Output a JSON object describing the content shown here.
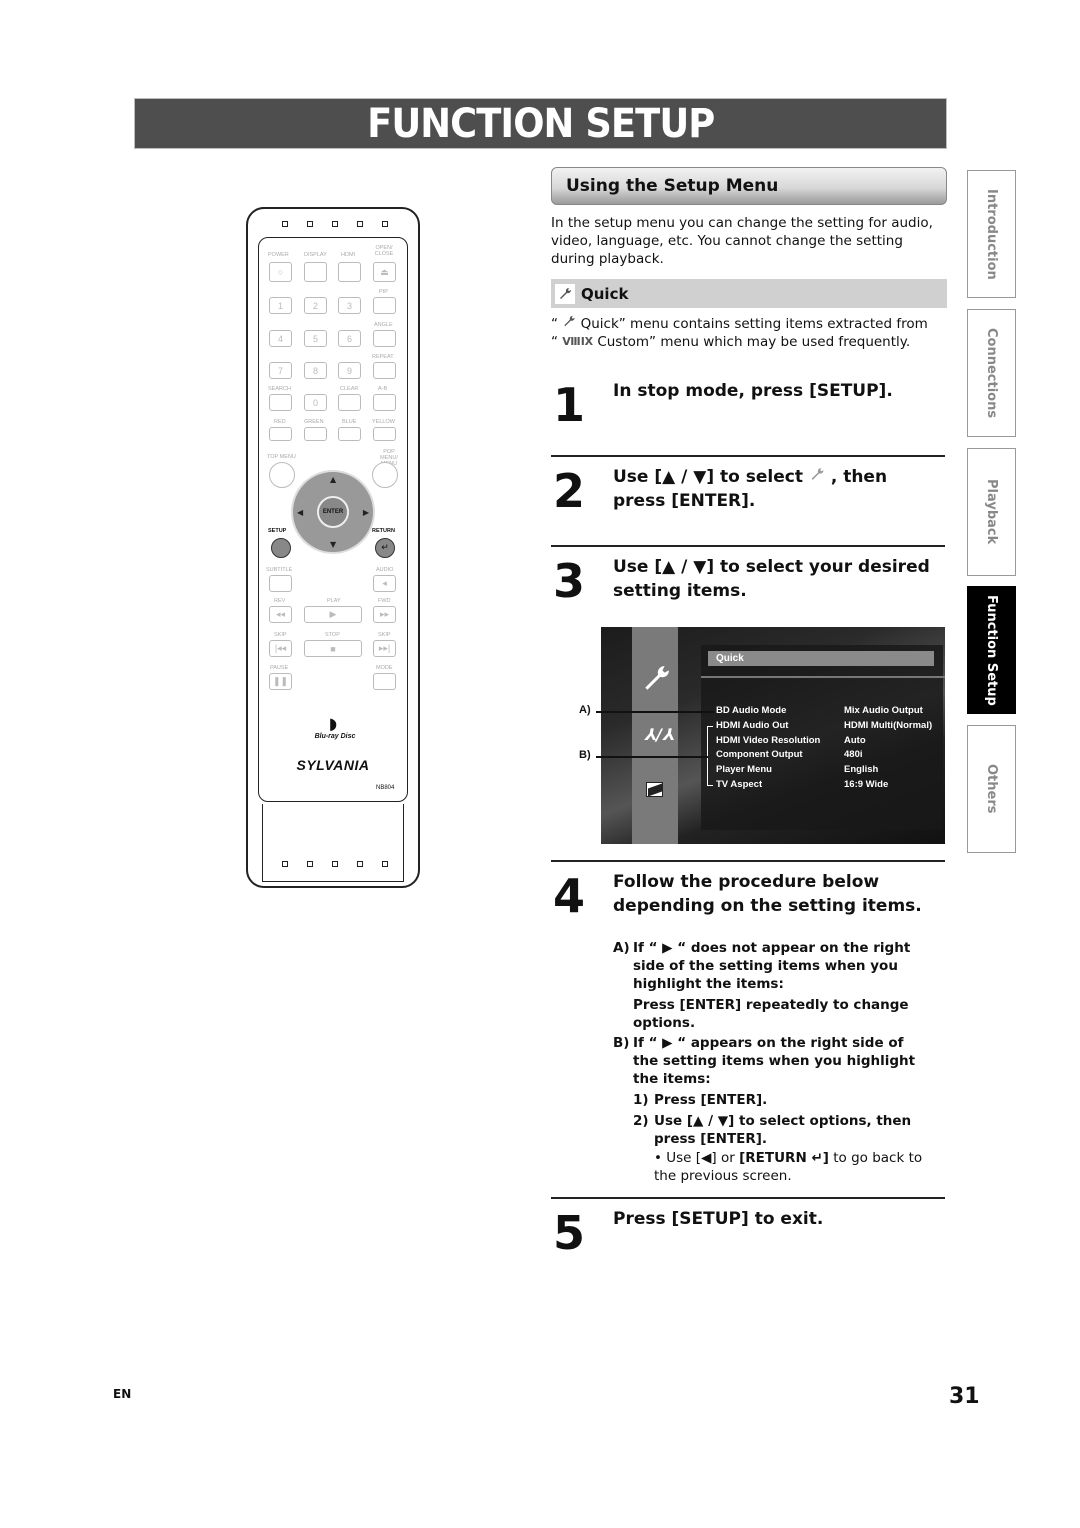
{
  "page": {
    "title": "FUNCTION SETUP",
    "language": "EN",
    "page_number": "31"
  },
  "section": {
    "header": "Using the Setup Menu",
    "intro": "In the setup menu you can change the setting for audio, video, language, etc. You cannot change the setting during playback.",
    "quick_label": "Quick",
    "quick_note_line1": "Quick” menu contains setting items extracted from",
    "quick_note_line2": "Custom” menu which may be used frequently.",
    "quote_open": "“"
  },
  "steps": [
    {
      "num": "1",
      "text": "In stop mode, press [SETUP]."
    },
    {
      "num": "2",
      "text_pre": "Use [▲ / ▼] to select",
      "text_post": ", then press [ENTER]."
    },
    {
      "num": "3",
      "text": "Use [▲ / ▼] to select your desired setting items."
    },
    {
      "num": "4",
      "text": "Follow the procedure below depending on the setting items."
    },
    {
      "num": "5",
      "text": "Press [SETUP] to exit."
    }
  ],
  "procedure": {
    "a_label": "A)",
    "a_text": "If “ ▶ “ does not appear on the right side of the setting items when you highlight the items:",
    "a_action": "Press [ENTER] repeatedly to change options.",
    "b_label": "B)",
    "b_text": "If “ ▶ “ appears on the right side of the setting items when you highlight the items:",
    "b_steps": [
      {
        "num": "1)",
        "text": "Press [ENTER]."
      },
      {
        "num": "2)",
        "text": "Use [▲ / ▼] to select options, then press [ENTER]."
      }
    ],
    "bullet_pre": "Use [◀] or",
    "bullet_bold": "[RETURN ↵]",
    "bullet_post": "to go back to the previous screen."
  },
  "screen": {
    "menu_title": "Quick",
    "callout_a": "A)",
    "callout_b": "B)",
    "items": [
      {
        "label": "BD Audio Mode",
        "value": "Mix Audio Output"
      },
      {
        "label": "HDMI Audio Out",
        "value": "HDMI Multi(Normal)"
      },
      {
        "label": "HDMI Video Resolution",
        "value": "Auto"
      },
      {
        "label": "Component Output",
        "value": "480i"
      },
      {
        "label": "Player Menu",
        "value": "English"
      },
      {
        "label": "TV Aspect",
        "value": "16:9 Wide"
      }
    ]
  },
  "side_tabs": [
    {
      "label": "Introduction",
      "active": false
    },
    {
      "label": "Connections",
      "active": false
    },
    {
      "label": "Playback",
      "active": false
    },
    {
      "label": "Function Setup",
      "active": true
    },
    {
      "label": "Others",
      "active": false
    }
  ],
  "remote": {
    "brand": "SYLVANIA",
    "model": "NB804",
    "disc_logo": "Blu-ray Disc",
    "labels": {
      "power": "POWER",
      "display": "DISPLAY",
      "hdmi": "HDMI",
      "open_close": "OPEN/ CLOSE",
      "pip": "PIP",
      "angle": "ANGLE",
      "repeat": "REPEAT",
      "search": "SEARCH",
      "clear": "CLEAR",
      "ab": "A-B",
      "red": "RED",
      "green": "GREEN",
      "blue": "BLUE",
      "yellow": "YELLOW",
      "top_menu": "TOP MENU",
      "pop_menu": "POP MENU/ MENU",
      "enter": "ENTER",
      "setup": "SETUP",
      "return": "RETURN",
      "subtitle": "SUBTITLE",
      "audio": "AUDIO",
      "rev": "REV",
      "play": "PLAY",
      "fwd": "FWD",
      "skip_back": "SKIP",
      "stop": "STOP",
      "skip_fwd": "SKIP",
      "pause": "PAUSE",
      "mode": "MODE"
    },
    "digits": [
      "1",
      "2",
      "3",
      "4",
      "5",
      "6",
      "7",
      "8",
      "9",
      "0"
    ]
  }
}
